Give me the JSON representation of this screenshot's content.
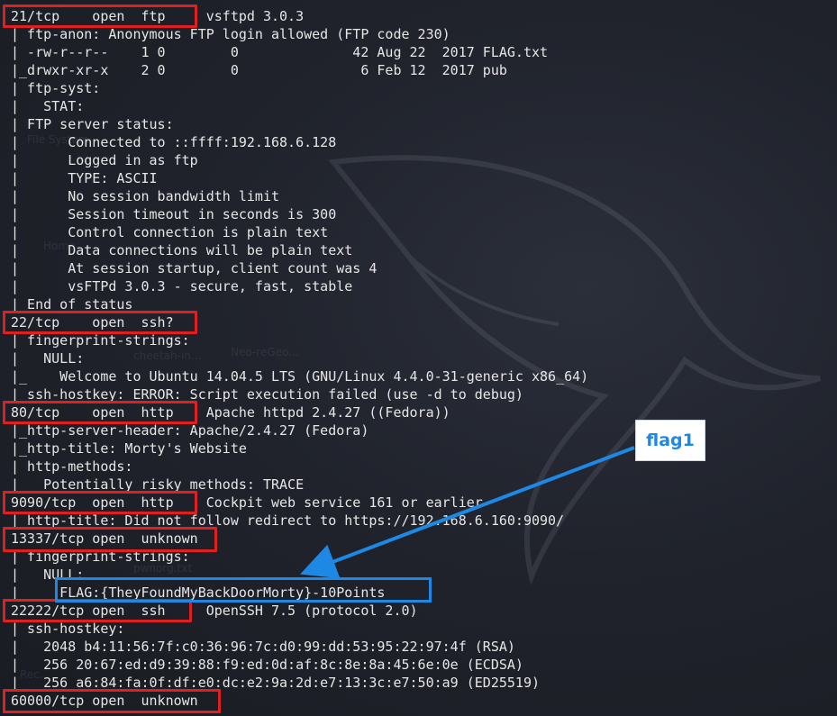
{
  "terminal": {
    "lines": [
      "21/tcp    open  ftp     vsftpd 3.0.3",
      "| ftp-anon: Anonymous FTP login allowed (FTP code 230)",
      "| -rw-r--r--    1 0        0              42 Aug 22  2017 FLAG.txt",
      "|_drwxr-xr-x    2 0        0               6 Feb 12  2017 pub",
      "| ftp-syst:",
      "|   STAT:",
      "| FTP server status:",
      "|      Connected to ::ffff:192.168.6.128",
      "|      Logged in as ftp",
      "|      TYPE: ASCII",
      "|      No session bandwidth limit",
      "|      Session timeout in seconds is 300",
      "|      Control connection is plain text",
      "|      Data connections will be plain text",
      "|      At session startup, client count was 4",
      "|      vsFTPd 3.0.3 - secure, fast, stable",
      "| End of status",
      "22/tcp    open  ssh?",
      "| fingerprint-strings:",
      "|   NULL:",
      "|_    Welcome to Ubuntu 14.04.5 LTS (GNU/Linux 4.4.0-31-generic x86_64)",
      "| ssh-hostkey: ERROR: Script execution failed (use -d to debug)",
      "80/tcp    open  http    Apache httpd 2.4.27 ((Fedora))",
      "|_http-server-header: Apache/2.4.27 (Fedora)",
      "|_http-title: Morty's Website",
      "| http-methods:",
      "|_  Potentially risky methods: TRACE",
      "9090/tcp  open  http    Cockpit web service 161 or earlier",
      "|_http-title: Did not follow redirect to https://192.168.6.160:9090/",
      "13337/tcp open  unknown",
      "| fingerprint-strings:",
      "|   NULL:",
      "|_    FLAG:{TheyFoundMyBackDoorMorty}-10Points",
      "22222/tcp open  ssh     OpenSSH 7.5 (protocol 2.0)",
      "| ssh-hostkey:",
      "|   2048 b4:11:56:7f:c0:36:96:7c:d0:99:dd:53:95:22:97:4f (RSA)",
      "|   256 20:67:ed:d9:39:88:f9:ed:0d:af:8c:8e:8a:45:6e:0e (ECDSA)",
      "|_  256 a6:84:fa:0f:df:e0:dc:e2:9a:2d:e7:13:3c:e7:50:a9 (ED25519)",
      "60000/tcp open  unknown"
    ]
  },
  "annotation": {
    "callout_label": "flag1",
    "highlight_color": "#e02020",
    "callout_color": "#1e88e5"
  },
  "background": {
    "ghost_labels": [
      "File System",
      "Home",
      "cheetah-in...",
      "Neo-reGeo...",
      "pwnorg.txt",
      "Rec..."
    ]
  }
}
